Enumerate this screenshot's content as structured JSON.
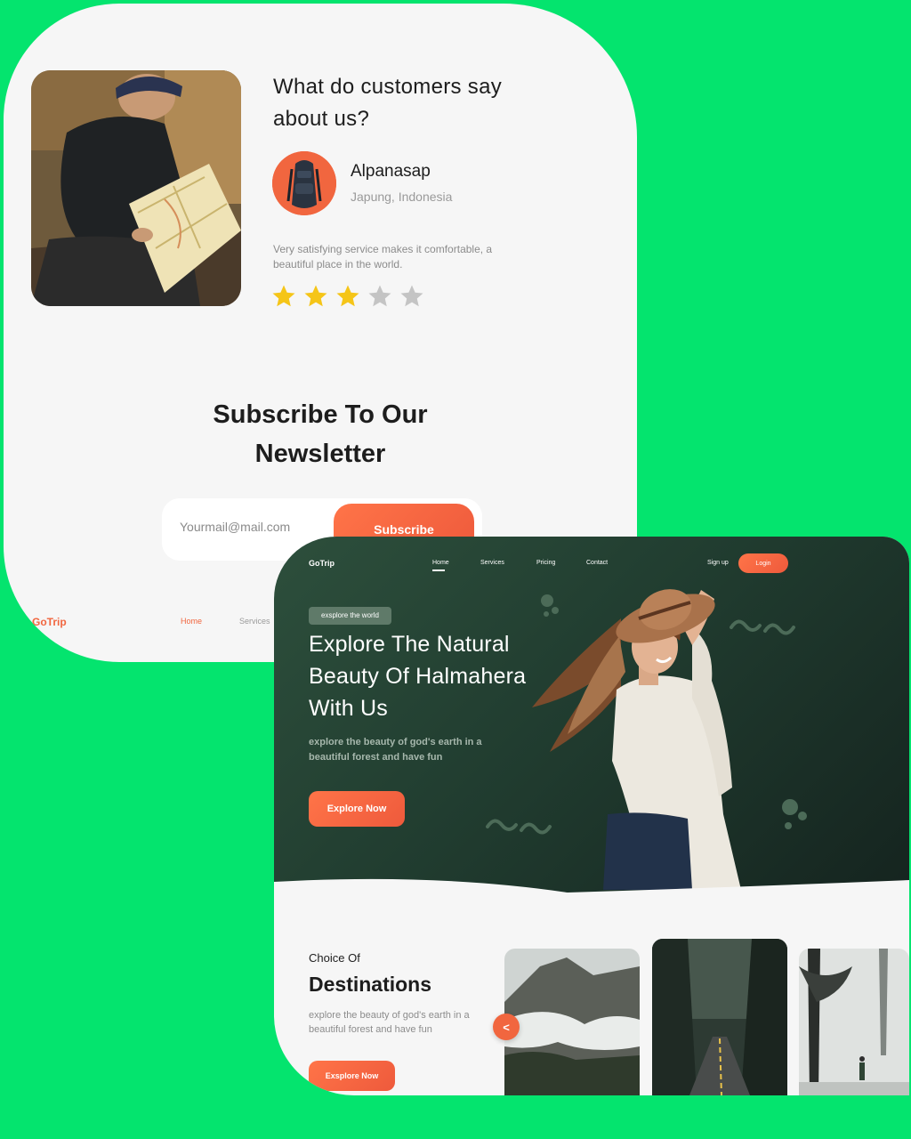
{
  "testimonial": {
    "title": "What do customers say about us?",
    "reviewer_name": "Alpanasap",
    "reviewer_location": "Japung, Indonesia",
    "review_text": "Very satisfying service makes it comfortable, a beautiful place in the world.",
    "rating": 3,
    "rating_max": 5
  },
  "newsletter": {
    "title_line1": "Subscribe To Our",
    "title_line2": "Newsletter",
    "email_placeholder": "Yourmail@mail.com",
    "subscribe_label": "Subscribe"
  },
  "footer": {
    "logo": "GoTrip",
    "home": "Home",
    "services": "Services"
  },
  "landing": {
    "nav": {
      "logo": "GoTrip",
      "home": "Home",
      "services": "Services",
      "pricing": "Pricing",
      "contact": "Contact",
      "signup": "Sign up",
      "login": "Login"
    },
    "hero": {
      "badge": "exsplore the world",
      "title": "Explore The Natural Beauty Of Halmahera With Us",
      "subtitle": "explore the beauty of god's earth in a beautiful forest and have fun",
      "button": "Explore Now"
    },
    "destinations": {
      "kicker": "Choice Of",
      "title": "Destinations",
      "subtitle": "explore the beauty of god's earth in a beautiful forest and have fun",
      "button": "Exsplore Now",
      "prev_icon": "<"
    }
  },
  "colors": {
    "background": "#04e46e",
    "accent": "#f1663f",
    "hero_dark": "#213d30",
    "star_filled": "#f5c518",
    "star_empty": "#c4c4c4"
  }
}
